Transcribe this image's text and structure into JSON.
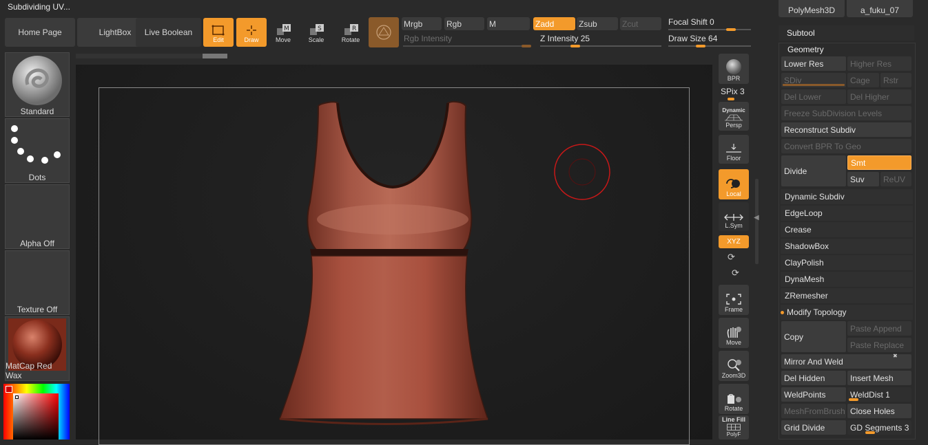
{
  "window": {
    "title": "Subdividing UV..."
  },
  "nav": {
    "home": "Home Page",
    "lightbox": "LightBox",
    "live_boolean": "Live Boolean"
  },
  "transform": {
    "edit": "Edit",
    "draw": "Draw",
    "move": "Move",
    "scale": "Scale",
    "rotate": "Rotate"
  },
  "color_modes": {
    "mrgb": "Mrgb",
    "rgb": "Rgb",
    "m": "M",
    "rgb_intensity": "Rgb Intensity"
  },
  "sculpt_modes": {
    "zadd": "Zadd",
    "zsub": "Zsub",
    "zcut": "Zcut",
    "z_intensity_label": "Z Intensity",
    "z_intensity_value": "25",
    "z_intensity_level": 0.25
  },
  "brush_params": {
    "focal_shift_label": "Focal Shift",
    "focal_shift_value": "0",
    "draw_size_label": "Draw Size",
    "draw_size_value": "64"
  },
  "left_panel": {
    "brush": "Standard",
    "stroke": "Dots",
    "alpha": "Alpha Off",
    "texture": "Texture Off",
    "material": "MatCap Red Wax"
  },
  "right_shelf": {
    "bpr": "BPR",
    "spix_label": "SPix",
    "spix_value": "3",
    "dynamic": "Dynamic",
    "persp": "Persp",
    "floor": "Floor",
    "local": "Local",
    "lsym": "L.Sym",
    "xyz": "XYZ",
    "frame": "Frame",
    "move": "Move",
    "zoom3d": "Zoom3D",
    "rotate": "Rotate",
    "line_fill": "Line Fill",
    "polyf": "PolyF"
  },
  "subtool_thumbs": {
    "polymesh": "PolyMesh3D",
    "fuku": "a_fuku_07"
  },
  "tool_panel": {
    "subtool": "Subtool",
    "geometry": "Geometry",
    "lower_res": "Lower Res",
    "higher_res": "Higher Res",
    "sdiv": "SDiv",
    "cage": "Cage",
    "rstr": "Rstr",
    "del_lower": "Del Lower",
    "del_higher": "Del Higher",
    "freeze": "Freeze SubDivision Levels",
    "reconstruct": "Reconstruct Subdiv",
    "convert_bpr": "Convert BPR To Geo",
    "divide": "Divide",
    "smt": "Smt",
    "suv": "Suv",
    "reuv": "ReUV",
    "dynamic_subdiv": "Dynamic Subdiv",
    "edgeloop": "EdgeLoop",
    "crease": "Crease",
    "shadowbox": "ShadowBox",
    "claypolish": "ClayPolish",
    "dynamesh": "DynaMesh",
    "zremesher": "ZRemesher",
    "modify_topology": "Modify Topology",
    "copy": "Copy",
    "paste_append": "Paste Append",
    "paste_replace": "Paste Replace",
    "mirror_weld": "Mirror And Weld",
    "del_hidden": "Del Hidden",
    "insert_mesh": "Insert Mesh",
    "weldpoints": "WeldPoints",
    "welddist_label": "WeldDist",
    "welddist_value": "1",
    "meshfrombrush": "MeshFromBrush",
    "close_holes": "Close Holes",
    "grid_divide": "Grid Divide",
    "gd_segments_label": "GD Segments",
    "gd_segments_value": "3"
  },
  "colors": {
    "accent": "#f39a2b",
    "panel": "#3b3b3b",
    "canvas": "#1d1d1d",
    "mesh": "#a85a47"
  }
}
